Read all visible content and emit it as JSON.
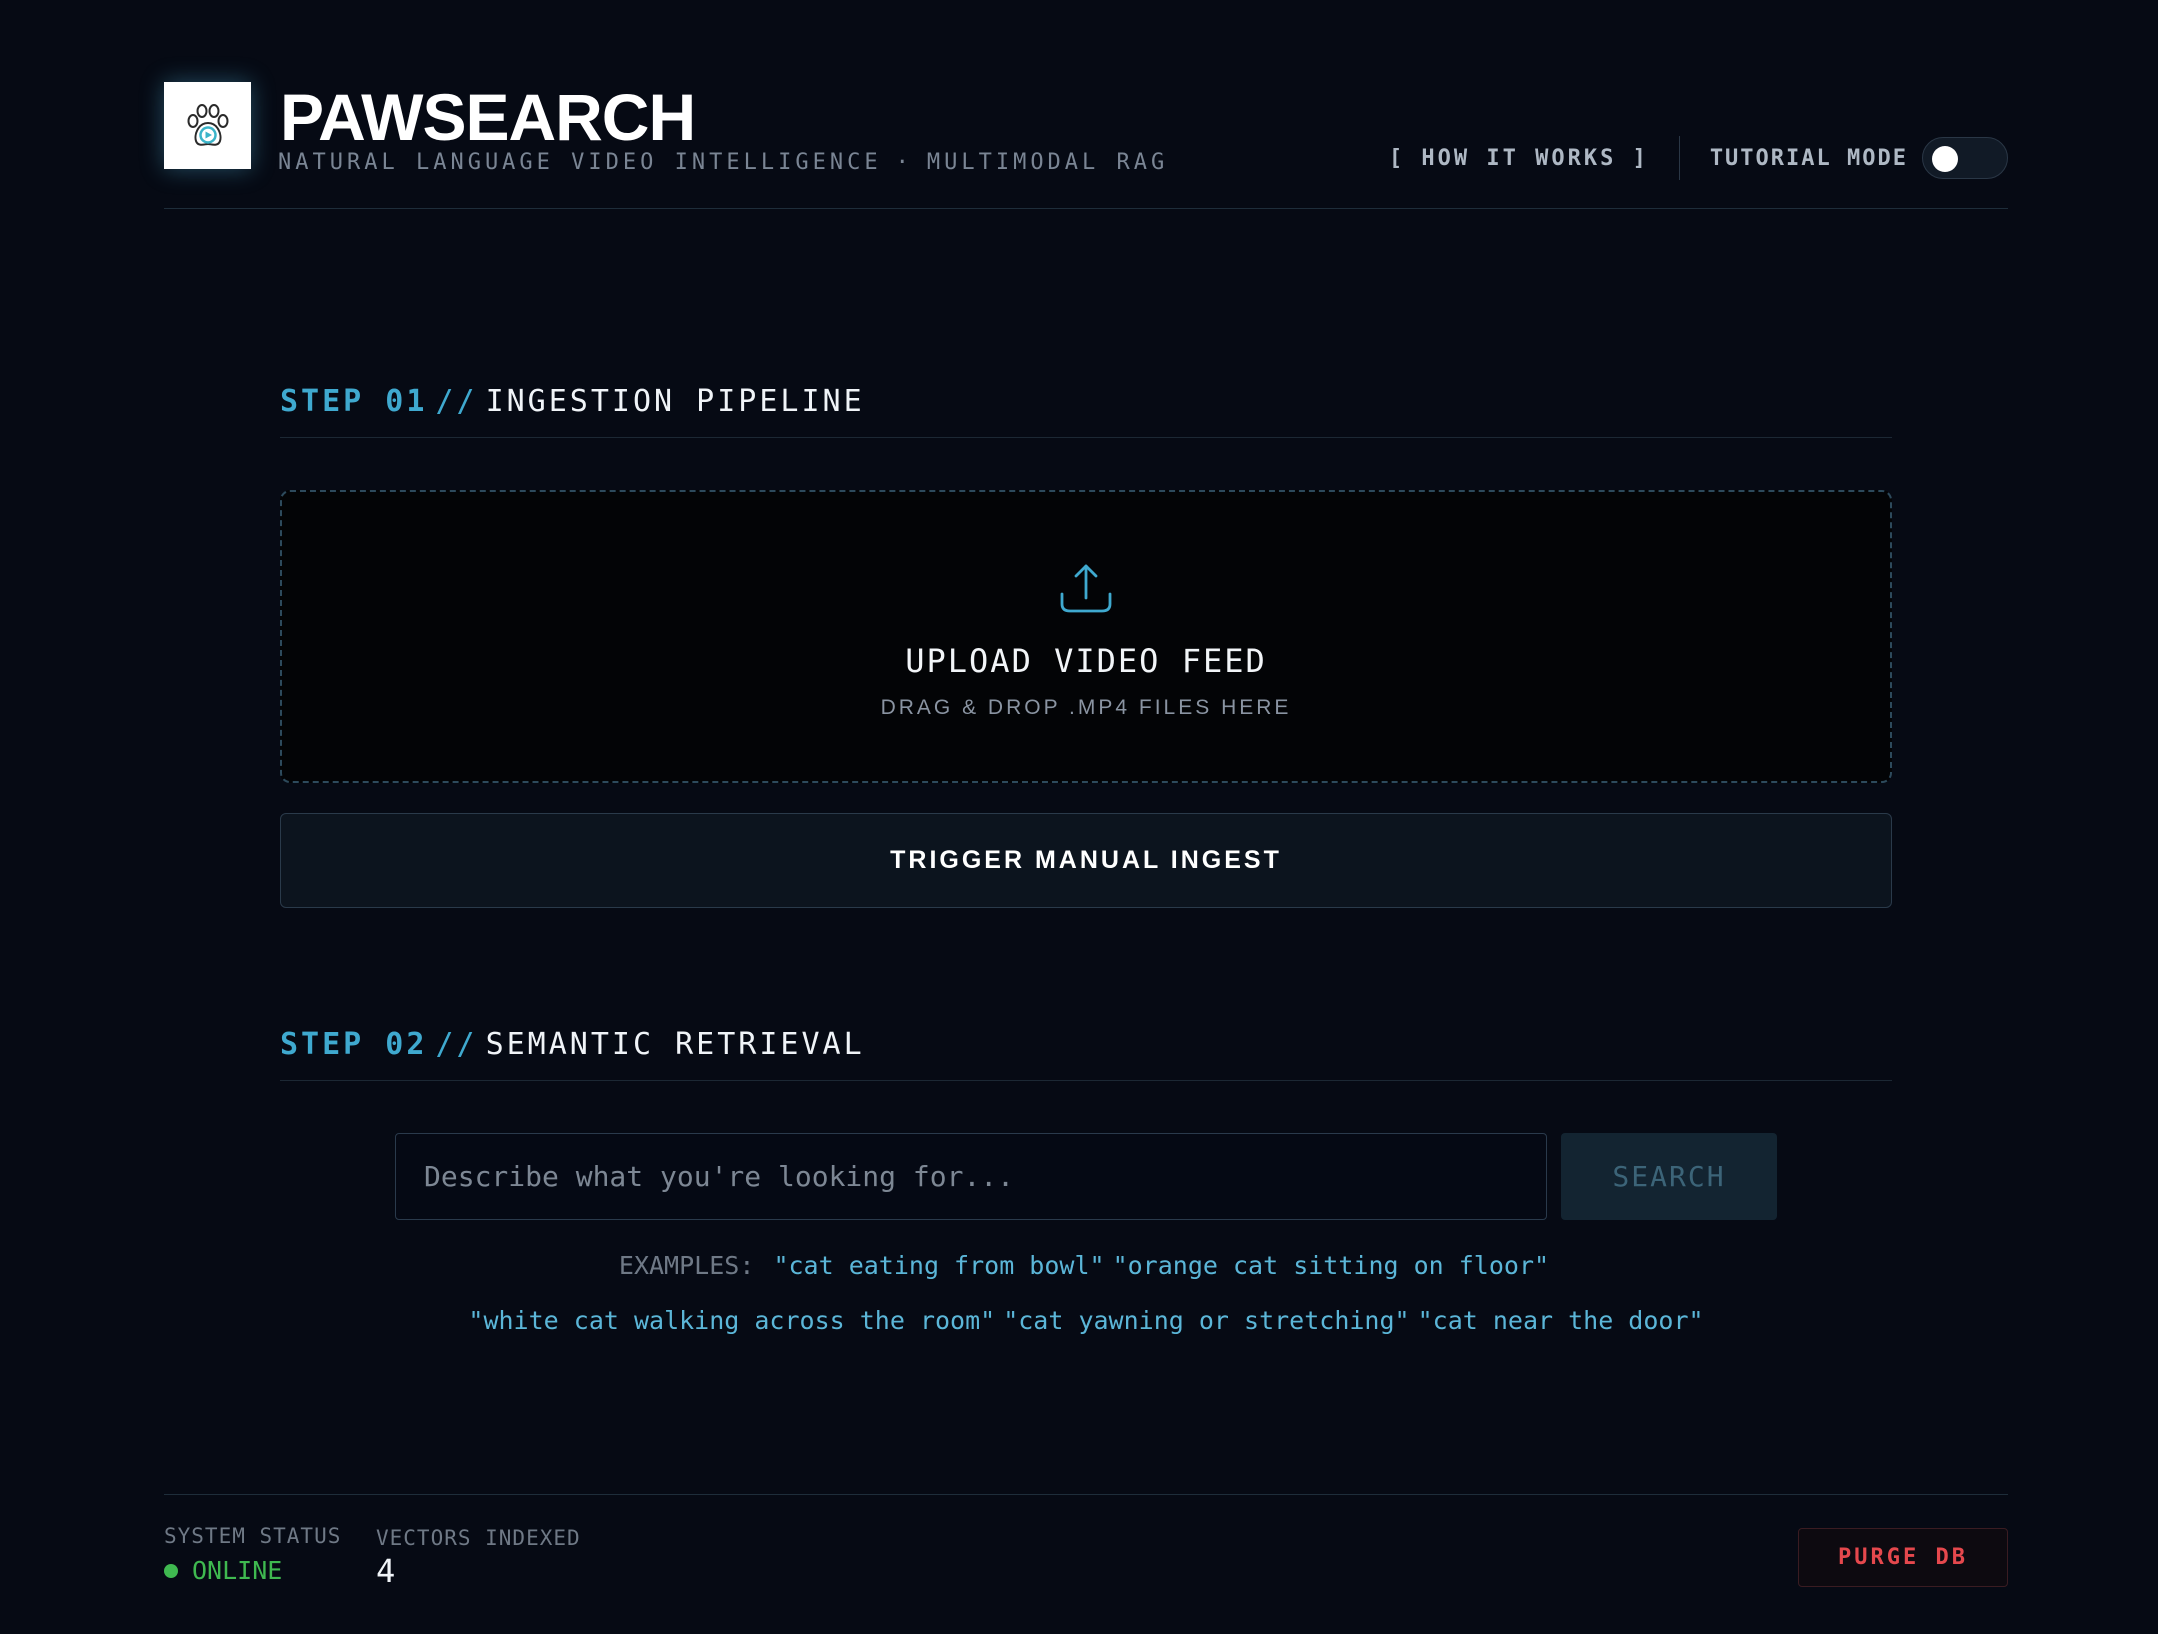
{
  "header": {
    "title": "PAWSEARCH",
    "subtitle_left": "NATURAL LANGUAGE VIDEO INTELLIGENCE",
    "subtitle_sep": "·",
    "subtitle_right": "MULTIMODAL RAG",
    "how_it_works": "[ HOW IT WORKS ]",
    "tutorial_label": "TUTORIAL MODE",
    "tutorial_enabled": false
  },
  "step1": {
    "step": "STEP 01",
    "slash": "//",
    "name": "INGESTION PIPELINE",
    "upload_title": "UPLOAD VIDEO FEED",
    "upload_sub": "DRAG & DROP .MP4 FILES HERE",
    "ingest_button": "TRIGGER MANUAL INGEST"
  },
  "step2": {
    "step": "STEP 02",
    "slash": "//",
    "name": "SEMANTIC RETRIEVAL",
    "search_placeholder": "Describe what you're looking for...",
    "search_value": "",
    "search_button": "SEARCH",
    "examples_label": "EXAMPLES:",
    "examples": [
      "\"cat eating from bowl\"",
      "\"orange cat sitting on floor\"",
      "\"white cat walking across the room\"",
      "\"cat yawning or stretching\"",
      "\"cat near the door\""
    ]
  },
  "footer": {
    "system_status_label": "SYSTEM STATUS",
    "system_status_value": "ONLINE",
    "vectors_label": "VECTORS INDEXED",
    "vectors_value": "4",
    "purge_button": "PURGE DB"
  },
  "colors": {
    "background": "#060a14",
    "accent": "#3fa9cf",
    "online": "#3fb950",
    "danger": "#e5484d"
  },
  "icons": {
    "logo": "paw-icon",
    "upload": "upload-icon",
    "status": "status-dot-icon"
  }
}
